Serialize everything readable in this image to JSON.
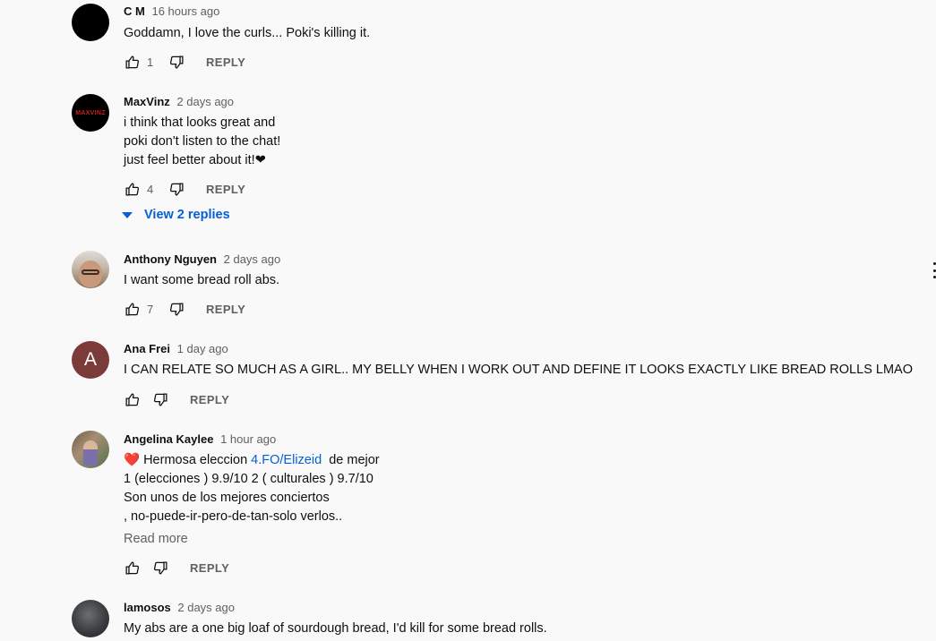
{
  "comments": [
    {
      "author": "C M",
      "time": "16 hours ago",
      "lines": [
        "Goddamn, I love the curls... Poki's killing it."
      ],
      "likes": "1",
      "reply_label": "REPLY"
    },
    {
      "author": "MaxVinz",
      "avatar_text": "MAXVINZ",
      "time": "2 days ago",
      "lines": [
        "i think that looks great and",
        "poki don't listen to the chat!",
        "just feel better about it!❤"
      ],
      "likes": "4",
      "reply_label": "REPLY",
      "view_replies": "View 2 replies"
    },
    {
      "author": "Anthony Nguyen",
      "time": "2 days ago",
      "lines": [
        "I want some bread roll abs."
      ],
      "likes": "7",
      "reply_label": "REPLY"
    },
    {
      "author": "Ana Frei",
      "avatar_letter": "A",
      "time": "1 day ago",
      "lines": [
        "I CAN RELATE SO MUCH AS A GIRL.. MY BELLY WHEN I WORK OUT AND DEFINE IT LOOKS EXACTLY LIKE BREAD ROLLS LMAO"
      ],
      "likes": "",
      "reply_label": "REPLY"
    },
    {
      "author": "Angelina Kaylee",
      "time": "1 hour ago",
      "line1_prefix": "❤️ Hermosa eleccion ",
      "line1_link": "4.FO/Elizeid",
      "line1_suffix": "  de mejor",
      "lines": [
        "1 (elecciones ) 9.9/10 2 ( culturales ) 9.7/10",
        "Son unos de los mejores conciertos",
        ", no-puede-ir-pero-de-tan-solo verlos.."
      ],
      "read_more": "Read more",
      "likes": "",
      "reply_label": "REPLY"
    },
    {
      "author": "lamosos",
      "time": "2 days ago",
      "lines": [
        "My abs are a one big loaf of sourdough bread, I'd kill for some bread rolls."
      ],
      "likes": "",
      "reply_label": "REPLY"
    }
  ],
  "colors": {
    "link": "#065fd4",
    "secondary_text": "#606060",
    "heart": "#e0245e"
  }
}
